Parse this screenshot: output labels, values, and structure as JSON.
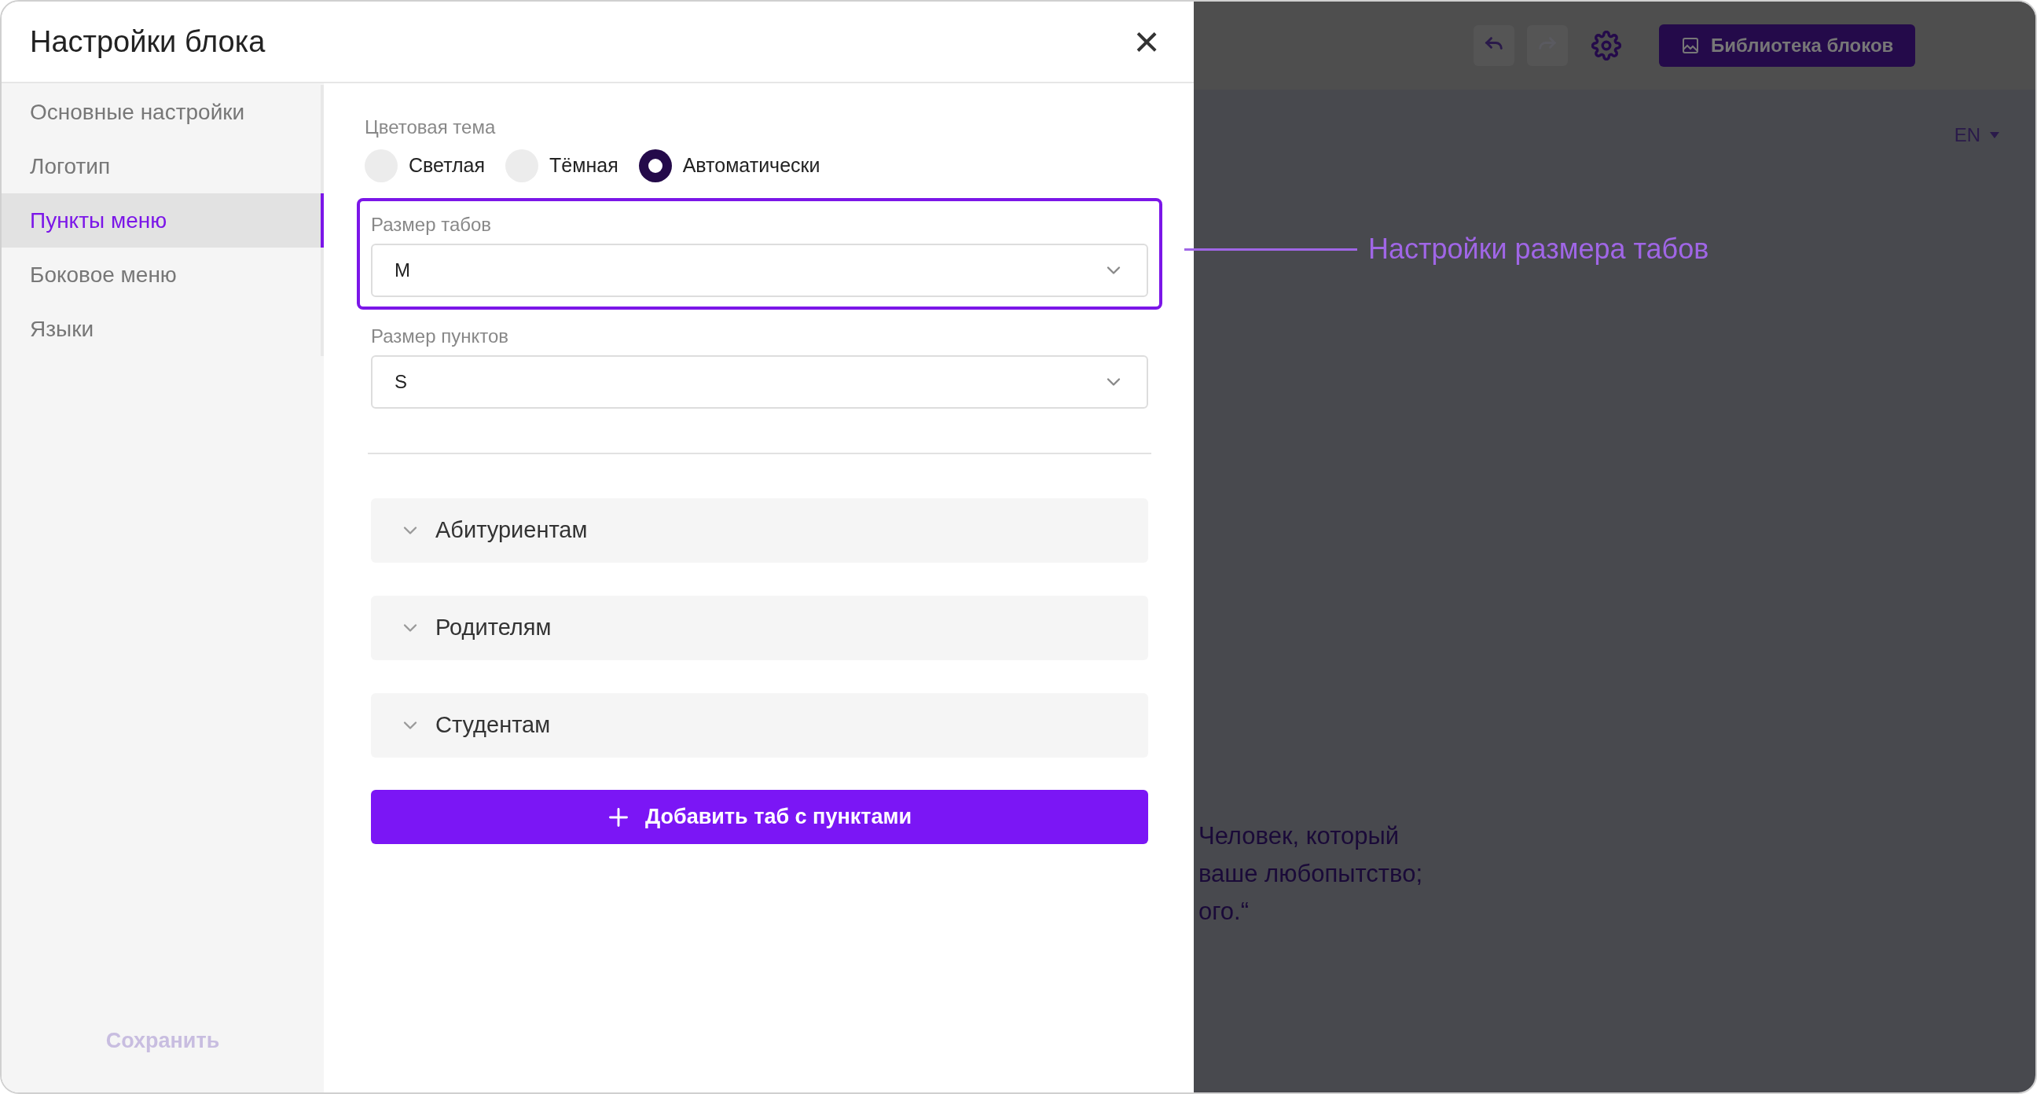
{
  "dialog": {
    "title": "Настройки блока",
    "close_label": "×"
  },
  "sidebar": {
    "items": [
      {
        "label": "Основные настройки",
        "selected": false
      },
      {
        "label": "Логотип",
        "selected": false
      },
      {
        "label": "Пункты меню",
        "selected": true
      },
      {
        "label": "Боковое меню",
        "selected": false
      },
      {
        "label": "Языки",
        "selected": false
      }
    ],
    "save_button": {
      "label": "Сохранить",
      "disabled": true
    }
  },
  "color_theme": {
    "label": "Цветовая тема",
    "options": [
      {
        "label": "Светлая",
        "selected": false
      },
      {
        "label": "Тёмная",
        "selected": false
      },
      {
        "label": "Автоматически",
        "selected": true
      }
    ]
  },
  "selects": [
    {
      "label": "Размер табов",
      "value": "M",
      "highlighted": true
    },
    {
      "label": "Размер пунктов",
      "value": "S",
      "highlighted": false
    }
  ],
  "tab_groups": [
    {
      "label": "Абитуриентам",
      "expanded": false
    },
    {
      "label": "Родителям",
      "expanded": false
    },
    {
      "label": "Студентам",
      "expanded": false
    }
  ],
  "add_button": {
    "label": "Добавить таб с пунктами"
  },
  "annotation": {
    "text": "Настройки размера табов"
  },
  "background_page": {
    "toolbar": {
      "library_button": "Библиотека блоков"
    },
    "language": "EN",
    "quote_lines": [
      "Человек, который",
      "ваше любопытство;",
      "ого.“"
    ]
  }
}
